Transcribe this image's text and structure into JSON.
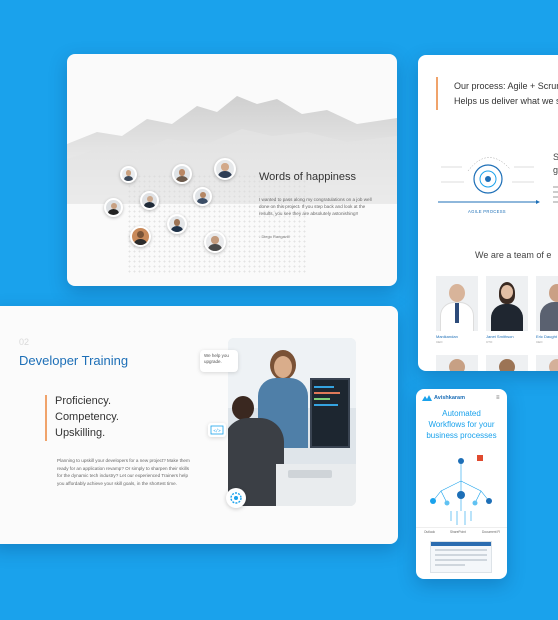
{
  "testimonials": {
    "title": "Words of happiness",
    "quote": "I wanted to pass along my congratulations on a job well done on this project. If you step back and look at the results, you see they are absolutely astonishing!!",
    "author": "- Diego Rangavill"
  },
  "training": {
    "number": "02",
    "title": "Developer Training",
    "lines": [
      "Proficiency.",
      "Competency.",
      "Upskilling."
    ],
    "body": "Planning to upskill your developers for a new project? Make them ready for an application revamp? Or simply to sharpen their skills for the dynamic tech industry? Let our experienced Trainers help you affordably achieve your skill goals, in the shortest time.",
    "bubble": "We help you upgrade."
  },
  "process": {
    "line1": "Our process: Agile + Scrum",
    "line2": "Helps us deliver what we s",
    "agile_label": "AGILE PROCESS",
    "side_title": [
      "S",
      "g"
    ],
    "team_heading": "We are a team of e",
    "members": [
      {
        "name": "Manikandan",
        "role": "CEO"
      },
      {
        "name": "Janet Smithson",
        "role": "CTO"
      },
      {
        "name": "Eric Daught",
        "role": "CEO"
      }
    ]
  },
  "mobile": {
    "brand": "Avishkaram",
    "menu_icon": "≡",
    "hero": [
      "Automated",
      "Workflows for your",
      "business processes"
    ],
    "tabs": [
      "Outlook",
      "SharePoint",
      "Document Fl"
    ]
  },
  "colors": {
    "background": "#1aa2ec",
    "brand_blue": "#1d6fb7",
    "accent_orange": "#f0a36b"
  }
}
